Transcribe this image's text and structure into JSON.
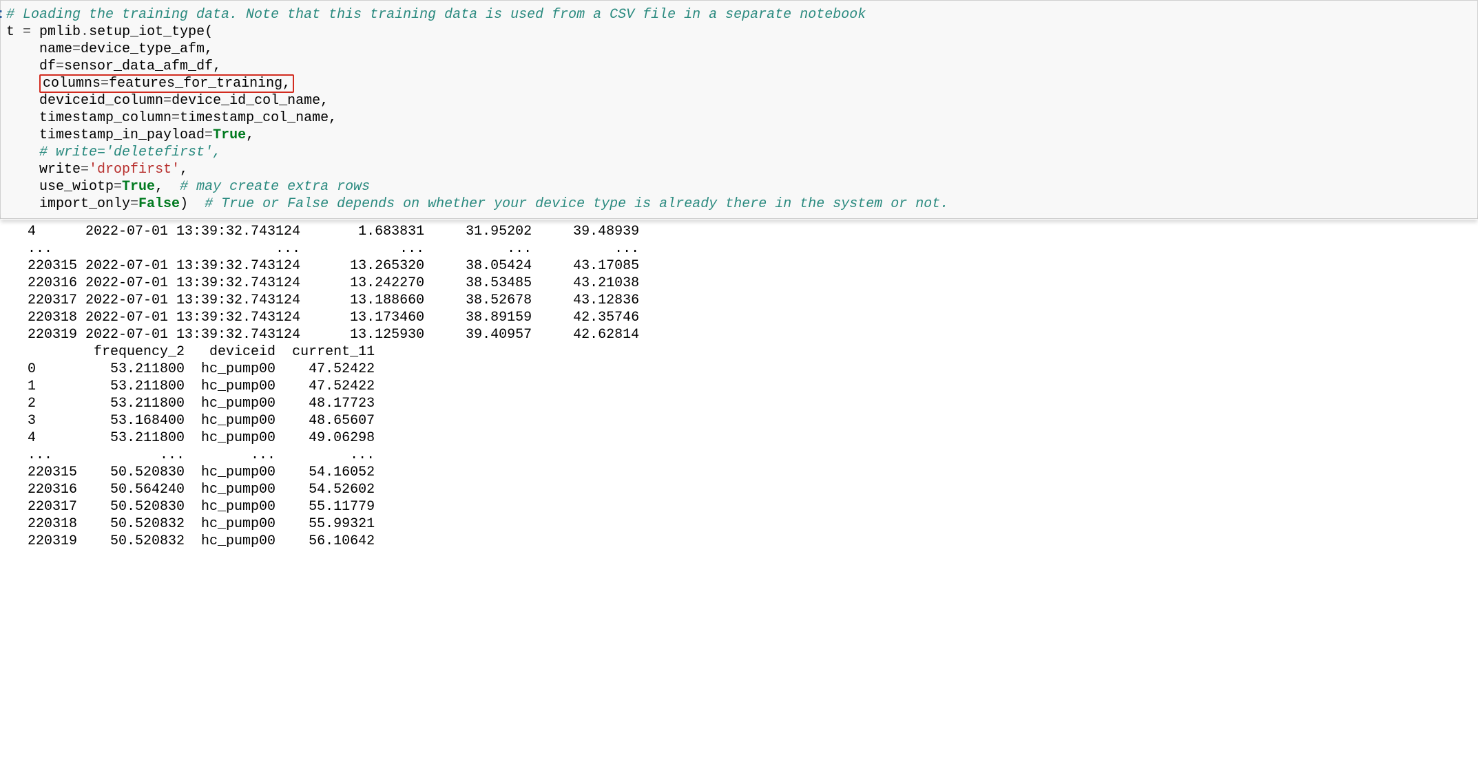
{
  "prompt": ":",
  "code": {
    "l1": "# Loading the training data. Note that this training data is used from a CSV file in a separate notebook",
    "l2a": "t ",
    "l2b": "=",
    "l2c": " pmlib",
    "l2d": ".",
    "l2e": "setup_iot_type(",
    "l3a": "    name",
    "l3b": "=",
    "l3c": "device_type_afm,",
    "l4a": "    df",
    "l4b": "=",
    "l4c": "sensor_data_afm_df,",
    "l5a": "    ",
    "l5b": "columns",
    "l5c": "=",
    "l5d": "features_for_training,",
    "l6a": "    deviceid_column",
    "l6b": "=",
    "l6c": "device_id_col_name,",
    "l7a": "    timestamp_column",
    "l7b": "=",
    "l7c": "timestamp_col_name,",
    "l8a": "    timestamp_in_payload",
    "l8b": "=",
    "l8c": "True",
    "l8d": ",",
    "l9": "    # write='deletefirst',",
    "l10a": "    write",
    "l10b": "=",
    "l10c": "'dropfirst'",
    "l10d": ",",
    "l11a": "    use_wiotp",
    "l11b": "=",
    "l11c": "True",
    "l11d": ",  ",
    "l11e": "# may create extra rows",
    "l12a": "    import_only",
    "l12b": "=",
    "l12c": "False",
    "l12d": ")  ",
    "l12e": "# True or False depends on whether your device type is already there in the system or not."
  },
  "output_block1": {
    "rows": [
      {
        "idx": "4     ",
        "ts": " 2022-07-01 13:39:32.743124",
        "c1": "       1.683831",
        "c2": "     31.95202",
        "c3": "     39.48939"
      },
      {
        "idx": "...   ",
        "ts": "                        ...",
        "c1": "            ...",
        "c2": "          ...",
        "c3": "          ..."
      },
      {
        "idx": "220315",
        "ts": " 2022-07-01 13:39:32.743124",
        "c1": "      13.265320",
        "c2": "     38.05424",
        "c3": "     43.17085"
      },
      {
        "idx": "220316",
        "ts": " 2022-07-01 13:39:32.743124",
        "c1": "      13.242270",
        "c2": "     38.53485",
        "c3": "     43.21038"
      },
      {
        "idx": "220317",
        "ts": " 2022-07-01 13:39:32.743124",
        "c1": "      13.188660",
        "c2": "     38.52678",
        "c3": "     43.12836"
      },
      {
        "idx": "220318",
        "ts": " 2022-07-01 13:39:32.743124",
        "c1": "      13.173460",
        "c2": "     38.89159",
        "c3": "     42.35746"
      },
      {
        "idx": "220319",
        "ts": " 2022-07-01 13:39:32.743124",
        "c1": "      13.125930",
        "c2": "     39.40957",
        "c3": "     42.62814"
      }
    ]
  },
  "output_block2": {
    "header": "        frequency_2   deviceid  current_11",
    "rows": [
      {
        "idx": "0     ",
        "c1": "    53.211800",
        "dev": "  hc_pump00",
        "c2": "    47.52422"
      },
      {
        "idx": "1     ",
        "c1": "    53.211800",
        "dev": "  hc_pump00",
        "c2": "    47.52422"
      },
      {
        "idx": "2     ",
        "c1": "    53.211800",
        "dev": "  hc_pump00",
        "c2": "    48.17723"
      },
      {
        "idx": "3     ",
        "c1": "    53.168400",
        "dev": "  hc_pump00",
        "c2": "    48.65607"
      },
      {
        "idx": "4     ",
        "c1": "    53.211800",
        "dev": "  hc_pump00",
        "c2": "    49.06298"
      },
      {
        "idx": "...   ",
        "c1": "          ...",
        "dev": "        ...",
        "c2": "         ..."
      },
      {
        "idx": "220315",
        "c1": "    50.520830",
        "dev": "  hc_pump00",
        "c2": "    54.16052"
      },
      {
        "idx": "220316",
        "c1": "    50.564240",
        "dev": "  hc_pump00",
        "c2": "    54.52602"
      },
      {
        "idx": "220317",
        "c1": "    50.520830",
        "dev": "  hc_pump00",
        "c2": "    55.11779"
      },
      {
        "idx": "220318",
        "c1": "    50.520832",
        "dev": "  hc_pump00",
        "c2": "    55.99321"
      },
      {
        "idx": "220319",
        "c1": "    50.520832",
        "dev": "  hc_pump00",
        "c2": "    56.10642"
      }
    ]
  }
}
